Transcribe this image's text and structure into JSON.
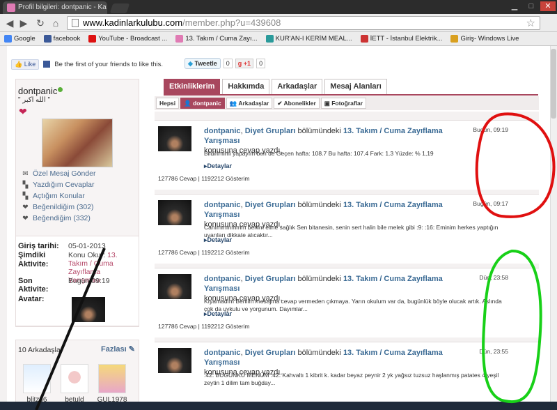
{
  "browser": {
    "tab_title": "Profil bilgileri: dontpanic - Ka",
    "url_host": "www.kadinlarkulubu.com",
    "url_path": "/member.php?u=439608"
  },
  "bookmarks": [
    {
      "label": "Google",
      "color": "#4285f4"
    },
    {
      "label": "facebook",
      "color": "#3b5998"
    },
    {
      "label": "YouTube - Broadcast ...",
      "color": "#d11"
    },
    {
      "label": "13. Takım / Cuma Zayı...",
      "color": "#e07bb4"
    },
    {
      "label": "KUR'AN-I KERİM MEAL...",
      "color": "#2a9a9a"
    },
    {
      "label": "İETT - İstanbul Elektrik...",
      "color": "#c33"
    },
    {
      "label": "Giriş- Windows Live",
      "color": "#d9a020"
    }
  ],
  "social": {
    "like_label": "Like",
    "fb_text": "Be the first of your friends to like this.",
    "tweet_label": "Tweetle",
    "tweet_count": "0",
    "gplus_label": "+1",
    "gplus_count": "0"
  },
  "profile": {
    "username": "dontpanic",
    "quote": "\" الله اكبر \"",
    "menu": [
      {
        "icon": "envelope-icon",
        "glyph": "✉",
        "label": "Özel Mesaj Gönder"
      },
      {
        "icon": "reply-icon",
        "glyph": "▚",
        "label": "Yazdığım Cevaplar"
      },
      {
        "icon": "topics-icon",
        "glyph": "▚",
        "label": "Açtığım Konular"
      },
      {
        "icon": "heart-icon",
        "glyph": "❤",
        "label": "Beğenildiğim (302)"
      },
      {
        "icon": "heart-icon",
        "glyph": "❤",
        "label": "Beğendiğim (332)"
      }
    ]
  },
  "info": {
    "join_label": "Giriş tarihi:",
    "join_value": "05-01-2013",
    "now_label1": "Şimdiki",
    "now_label2": "Aktivite:",
    "now_prefix": "Konu Okur:",
    "now_topic": "13. Takım / Cuma Zayıflama Yarışması",
    "last_label1": "Son",
    "last_label2": "Aktivite:",
    "last_value": "Bugün 09:19",
    "avatar_label": "Avatar:"
  },
  "friends": {
    "title": "10 Arkadaşlar",
    "more": "Fazlası",
    "list": [
      "blitz86",
      "betuld",
      "GUL1978"
    ]
  },
  "tabs": [
    "Etkinliklerim",
    "Hakkımda",
    "Arkadaşlar",
    "Mesaj Alanları"
  ],
  "subtabs": [
    "Hepsi",
    "dontpanic",
    "Arkadaşlar",
    "Abonelikler",
    "Fotoğraflar"
  ],
  "stream": [
    {
      "user": "dontpanic",
      "group": "Diyet Grupları",
      "mid": " bölümündeki ",
      "topic": "13. Takım / Cuma Zayıflama Yarışması",
      "suffix": "konusuna cevap yazdı.",
      "time": "Bugün, 09:19",
      "body": "Bildirimimi yapayım ben de Geçen hafta: 108.7 Bu hafta: 107.4 Fark: 1.3 Yüzde: % 1,19",
      "details": "▸Detaylar",
      "stats": "127786 Cevap | 1192212 Gösterim"
    },
    {
      "user": "dontpanic",
      "group": "Diyet Grupları",
      "mid": " bölümündeki ",
      "topic": "13. Takım / Cuma Zayıflama Yarışması",
      "suffix": "konusuna cevap yazdı.",
      "time": "Bugün, 09:17",
      "body": "Canımmmmmm benim eline sağlık Sen bitanesin, senin sert halin bile melek gibi :9: :16: Eminim herkes yaptığın uyarıları dikkate alıcaktır...",
      "details": "▸Detaylar",
      "stats": "127786 Cevap | 1192212 Gösterim"
    },
    {
      "user": "dontpanic",
      "group": "Diyet Grupları",
      "mid": " bölümündeki ",
      "topic": "13. Takım / Cuma Zayıflama Yarışması",
      "suffix": "konusuna cevap yazdı.",
      "time": "Dün, 23:58",
      "body": "Kıyamadım Berilim mesajına cevap vermeden çıkmaya. Yarın okulum var da, bugünlük böyle olucak artık. Aslında çok da uykulu ve yorgunum. Dayımlar...",
      "details": "▸Detaylar",
      "stats": "127786 Cevap | 1192212 Gösterim"
    },
    {
      "user": "dontpanic",
      "group": "Diyet Grupları",
      "mid": " bölümündeki ",
      "topic": "13. Takım / Cuma Zayıflama Yarışması",
      "suffix": "konusuna cevap yazdı.",
      "time": "Dün, 23:55",
      "body": ":42: BUGÜNKÜ MENÜM :42: Kahvaltı 1 kibrit k. kadar beyaz peynir 2 yk yağsız tuzsuz haşlanmış patates 4 yeşil zeytin 1 dilim tam buğday...",
      "details": "",
      "stats": ""
    }
  ]
}
